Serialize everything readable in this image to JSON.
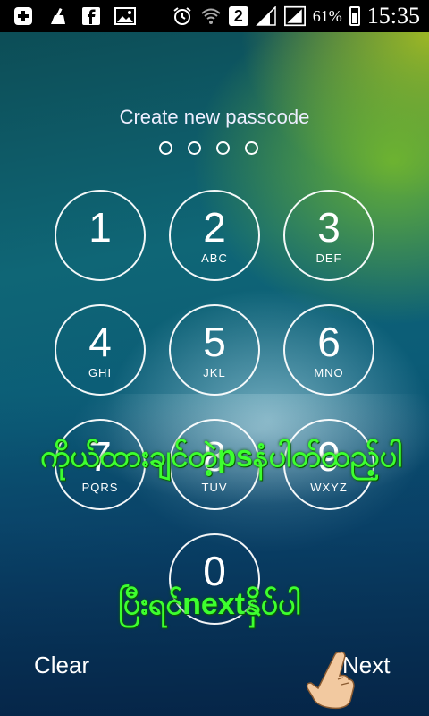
{
  "statusbar": {
    "left_icons": [
      "add-icon",
      "cleaner-icon",
      "facebook-icon",
      "gallery-icon"
    ],
    "sim_badge": "2",
    "battery": "61%",
    "time": "15:35"
  },
  "screen": {
    "title": "Create new passcode",
    "dot_count": 4,
    "keys": [
      {
        "num": "1",
        "letters": ""
      },
      {
        "num": "2",
        "letters": "ABC"
      },
      {
        "num": "3",
        "letters": "DEF"
      },
      {
        "num": "4",
        "letters": "GHI"
      },
      {
        "num": "5",
        "letters": "JKL"
      },
      {
        "num": "6",
        "letters": "MNO"
      },
      {
        "num": "7",
        "letters": "PQRS"
      },
      {
        "num": "8",
        "letters": "TUV"
      },
      {
        "num": "9",
        "letters": "WXYZ"
      },
      {
        "num": "0",
        "letters": ""
      }
    ],
    "overlay_text_1": "ကိုယ်ထားချင်တဲ့psနံပါတ်ထည့်ပါ",
    "overlay_text_2": "ပြီးရင်nextနှိပ်ပါ",
    "clear_label": "Clear",
    "next_label": "Next"
  }
}
